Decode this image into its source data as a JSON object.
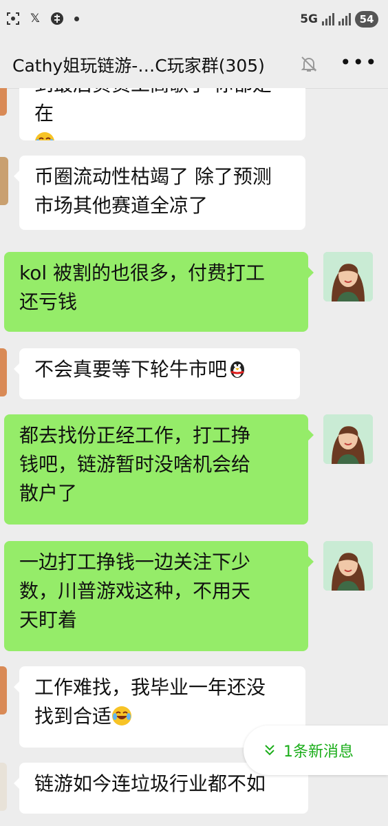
{
  "status": {
    "network": "5G",
    "battery": "54"
  },
  "header": {
    "title": "Cathy姐玩链游-…C玩家群(305)"
  },
  "messages": [
    {
      "side": "in",
      "text": "到最后负责工高歌了 你都是在",
      "emoji": "laugh-cry"
    },
    {
      "side": "in",
      "lines": [
        "币圈流动性枯竭了 除了预测",
        "市场其他赛道全凉了"
      ]
    },
    {
      "side": "out",
      "lines": [
        "kol 被割的也很多，付费打工",
        "还亏钱"
      ]
    },
    {
      "side": "in",
      "lines": [
        "不会真要等下轮牛市吧"
      ],
      "emoji": "penguin"
    },
    {
      "side": "out",
      "lines": [
        "都去找份正经工作，打工挣",
        "钱吧，链游暂时没啥机会给",
        "散户了"
      ]
    },
    {
      "side": "out",
      "lines": [
        "一边打工挣钱一边关注下少",
        "数，川普游戏这种，不用天",
        "天盯着"
      ]
    },
    {
      "side": "in",
      "lines": [
        "工作难找，我毕业一年还没",
        "找到合适"
      ],
      "emoji": "laugh-cry"
    },
    {
      "side": "in",
      "lines": [
        "链游如今连垃圾行业都不如"
      ]
    }
  ],
  "new_messages": {
    "label": "1条新消息"
  },
  "colors": {
    "out_bubble": "#95ec69",
    "in_bubble": "#ffffff",
    "background": "#ededed",
    "accent": "#1aad19"
  }
}
